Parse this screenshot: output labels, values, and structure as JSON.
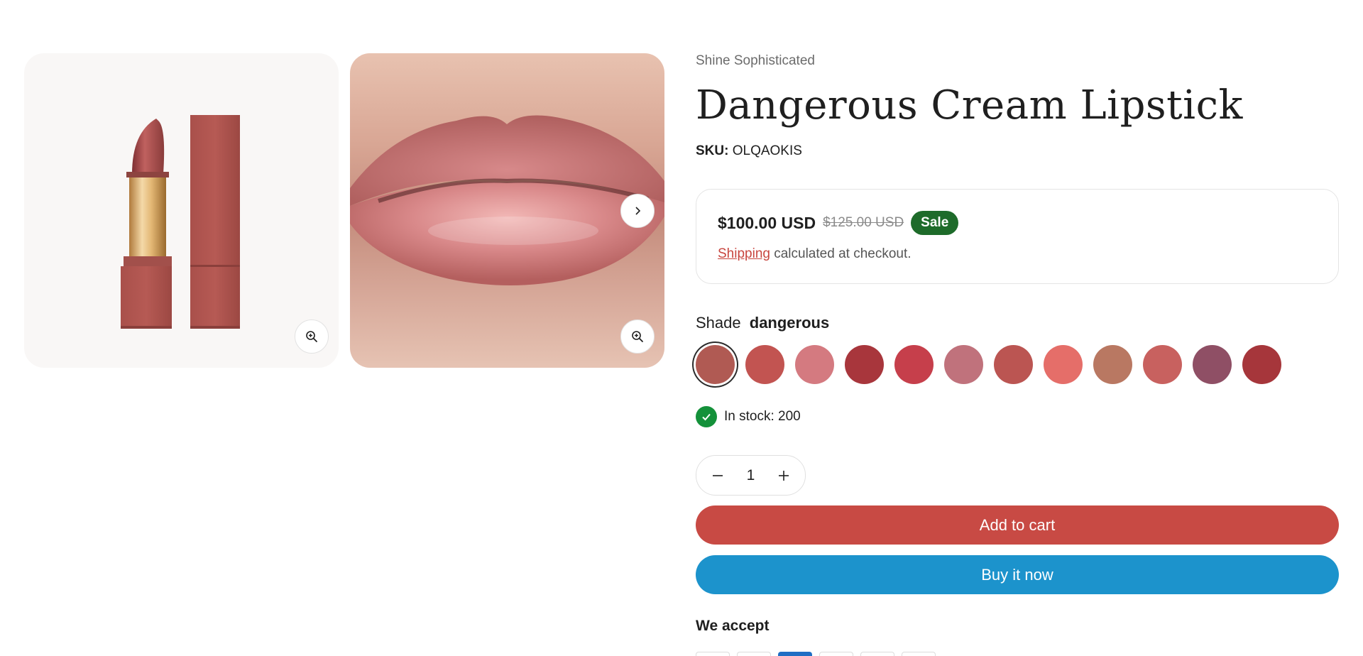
{
  "product": {
    "vendor": "Shine Sophisticated",
    "title": "Dangerous Cream Lipstick",
    "sku_label": "SKU:",
    "sku_value": "OLQAOKIS"
  },
  "price": {
    "current": "$100.00 USD",
    "compare_at": "$125.00 USD",
    "badge": "Sale",
    "shipping_link": "Shipping",
    "shipping_text": " calculated at checkout."
  },
  "shade": {
    "label": "Shade",
    "selected": "dangerous",
    "swatch_colors": [
      "#b05a53",
      "#c25451",
      "#d47a80",
      "#a8363c",
      "#c63f4b",
      "#c0727c",
      "#bb5552",
      "#e56e69",
      "#b97862",
      "#c8615f",
      "#8f4f65",
      "#a6363b"
    ]
  },
  "stock": {
    "text": "In stock: 200"
  },
  "quantity": {
    "value": "1"
  },
  "buttons": {
    "add_to_cart": "Add to cart",
    "buy_now": "Buy it now"
  },
  "payments": {
    "heading": "We accept",
    "icons": [
      "card-icon",
      "card-icon",
      "amex-icon",
      "card-icon",
      "card-icon",
      "card-icon"
    ]
  },
  "colors": {
    "accent_red": "#c84a44",
    "buy_blue": "#1c93cc",
    "sale_green": "#1e6b2a",
    "stock_green": "#14913a"
  }
}
